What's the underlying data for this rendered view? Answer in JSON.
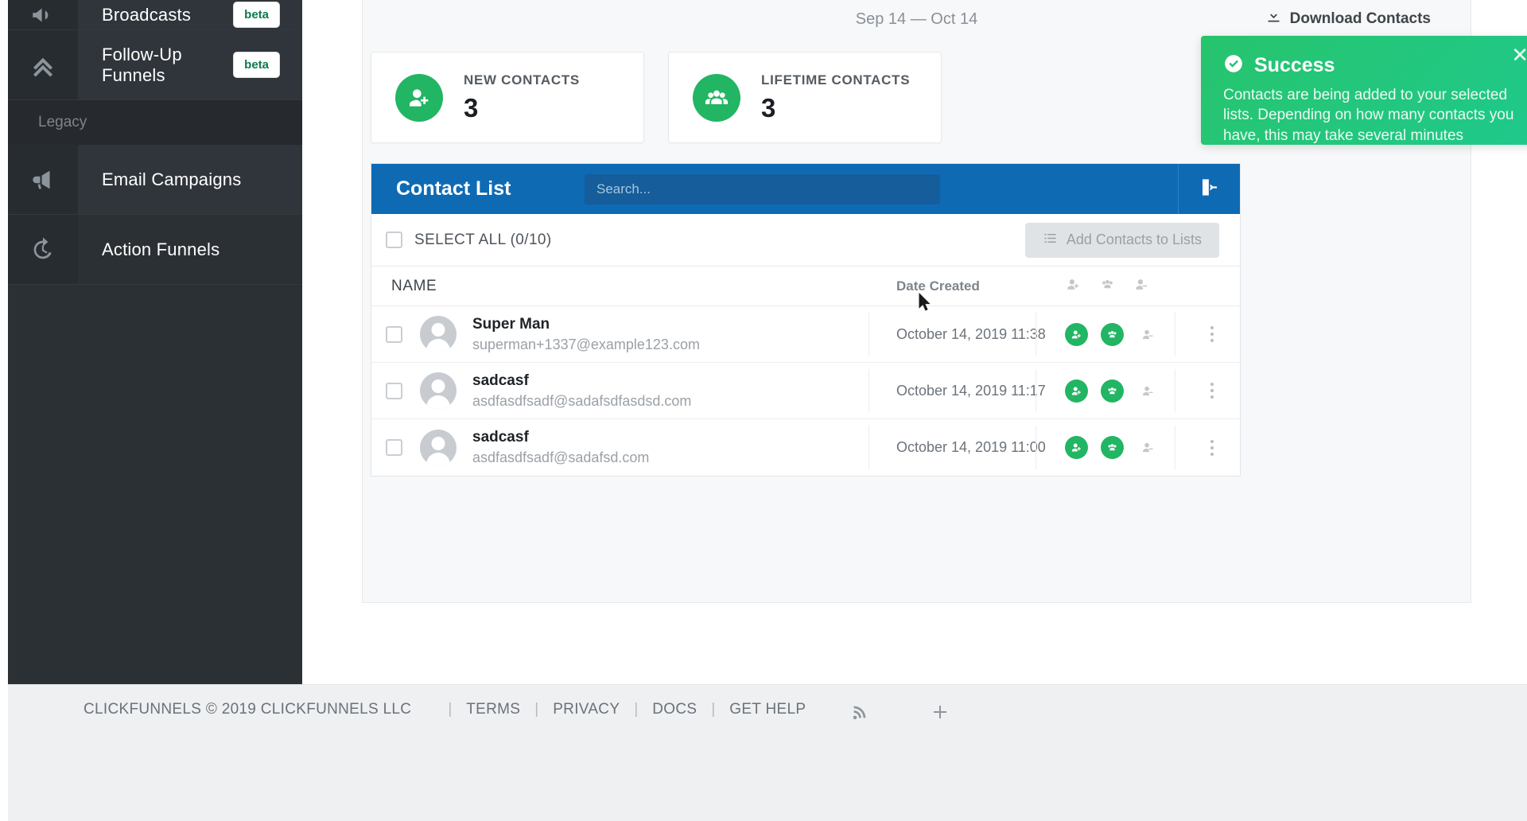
{
  "sidebar": {
    "items": [
      {
        "label": "Broadcasts",
        "badge": "beta",
        "icon": "megaphone-icon"
      },
      {
        "label": "Follow-Up Funnels",
        "badge": "beta",
        "icon": "chevron-double-up-icon"
      }
    ],
    "section_label": "Legacy",
    "legacy_items": [
      {
        "label": "Email Campaigns",
        "icon": "bullhorn-icon"
      },
      {
        "label": "Action Funnels",
        "icon": "history-icon"
      }
    ]
  },
  "header": {
    "date_range": "Sep 14 — Oct 14",
    "download_label": "Download Contacts",
    "download_icon": "download-icon"
  },
  "stats": [
    {
      "label": "NEW CONTACTS",
      "value": "3",
      "icon": "user-plus-icon",
      "color": "#22b563"
    },
    {
      "label": "LIFETIME CONTACTS",
      "value": "3",
      "icon": "users-icon",
      "color": "#22b563"
    }
  ],
  "toast": {
    "type": "success",
    "icon": "check-circle-icon",
    "title": "Success",
    "message": "Contacts are being added to your selected lists. Depending on how many contacts you have, this may take several minutes",
    "close_label": "✕",
    "color": "#27c46d"
  },
  "contact_list": {
    "title": "Contact List",
    "search_placeholder": "Search...",
    "search_value": "",
    "export_icon": "export-icon",
    "select_all_label": "SELECT ALL (0/10)",
    "add_to_lists_label": "Add Contacts to Lists",
    "add_to_lists_icon": "list-icon",
    "columns": {
      "name": "NAME",
      "date_created": "Date Created"
    },
    "header_icons": [
      "user-plus-icon",
      "users-icon",
      "user-minus-icon"
    ],
    "rows": [
      {
        "name": "Super Man",
        "email": "superman+1337@example123.com",
        "date": "October 14, 2019 11:38",
        "actions": [
          "user-plus-icon",
          "users-icon",
          "user-minus-icon"
        ]
      },
      {
        "name": "sadcasf",
        "email": "asdfasdfsadf@sadafsdfasdsd.com",
        "date": "October 14, 2019 11:17",
        "actions": [
          "user-plus-icon",
          "users-icon",
          "user-minus-icon"
        ]
      },
      {
        "name": "sadcasf",
        "email": "asdfasdfsadf@sadafsd.com",
        "date": "October 14, 2019 11:00",
        "actions": [
          "user-plus-icon",
          "users-icon",
          "user-minus-icon"
        ]
      }
    ]
  },
  "footer": {
    "copyright": "CLICKFUNNELS © 2019 CLICKFUNNELS LLC",
    "sep": "|",
    "links": [
      "TERMS",
      "PRIVACY",
      "DOCS",
      "GET HELP"
    ],
    "icons": [
      "rss-icon",
      "plus-icon"
    ]
  },
  "colors": {
    "accent_blue": "#0f6ab4",
    "accent_green": "#22b563",
    "sidebar_bg": "#2b3035",
    "footer_bg": "#eef0f2"
  }
}
